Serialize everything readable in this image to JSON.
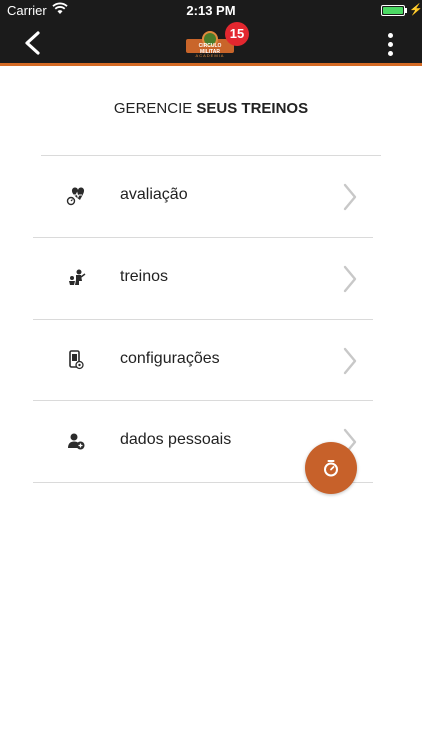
{
  "status_bar": {
    "carrier": "Carrier",
    "time": "2:13 PM",
    "battery_bolt": "⚡"
  },
  "nav": {
    "logo_name": "CIRCULO MILITAR",
    "logo_sub": "ACADEMIA",
    "notification_count": "15"
  },
  "page": {
    "title_regular": "GERENCIE ",
    "title_bold": "SEUS TREINOS"
  },
  "menu": [
    {
      "label": "avaliação",
      "icon": "heart-scale-icon"
    },
    {
      "label": "treinos",
      "icon": "trainer-icon"
    },
    {
      "label": "configurações",
      "icon": "phone-settings-icon"
    },
    {
      "label": "dados pessoais",
      "icon": "user-add-icon"
    }
  ],
  "colors": {
    "accent": "#c7612a",
    "topbar": "#1b1b1b",
    "badge": "#e3272f"
  }
}
